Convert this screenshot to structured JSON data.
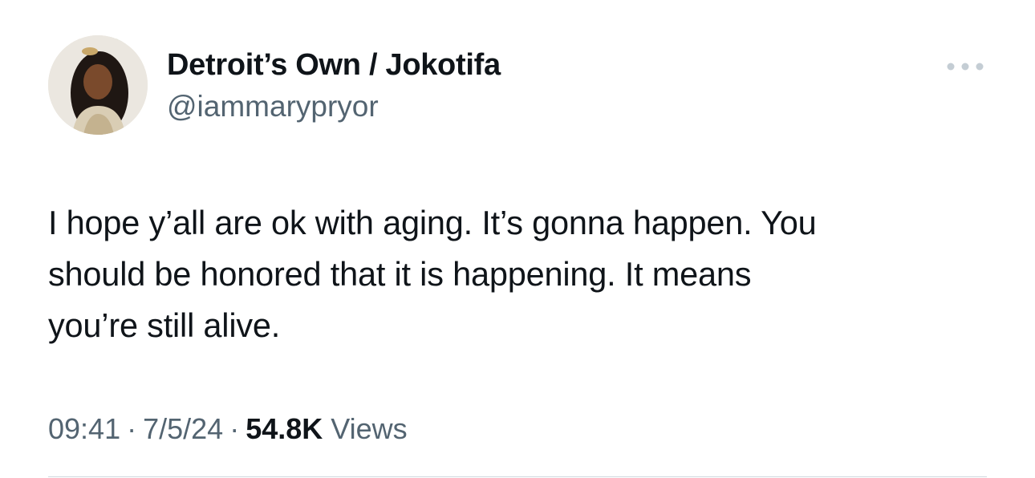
{
  "author": {
    "display_name": "Detroit’s Own / Jokotifa",
    "handle": "@iammarypryor"
  },
  "tweet": {
    "text": "I hope y’all are ok with aging. It’s gonna happen. You\nshould be honored that it is happening. It means\nyou’re still alive."
  },
  "meta": {
    "time": "09:41",
    "separator": "·",
    "date": "7/5/24",
    "views_count": "54.8K",
    "views_label": "Views"
  },
  "icons": {
    "more": "more-horizontal-icon"
  },
  "colors": {
    "text_primary": "#0f1419",
    "text_secondary": "#536471",
    "divider": "#cfd9de"
  }
}
